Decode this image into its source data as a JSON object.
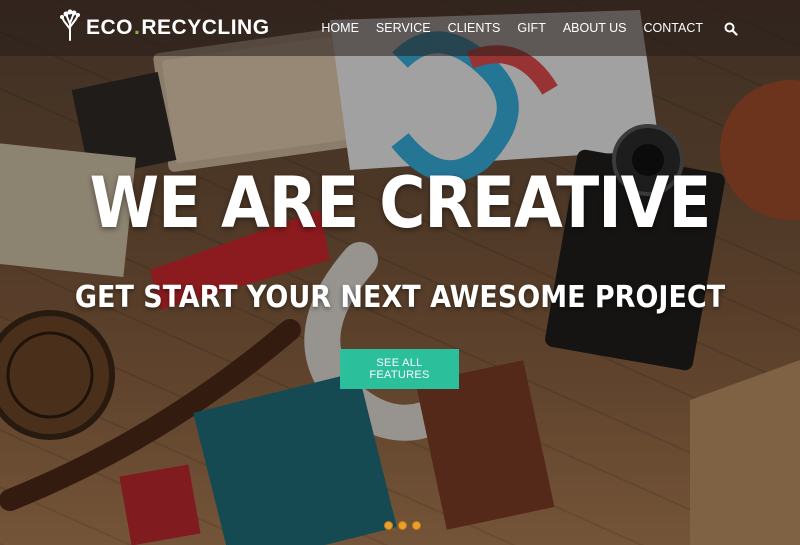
{
  "brand": {
    "name_part1": "ECO",
    "dot": ".",
    "name_part2": "RECYCLING"
  },
  "nav": {
    "items": [
      "HOME",
      "SERVICE",
      "CLIENTS",
      "GIFT",
      "ABOUT US",
      "CONTACT"
    ]
  },
  "hero": {
    "headline": "WE ARE CREATIVE",
    "subline": "GET START YOUR NEXT AWESOME PROJECT",
    "cta_label": "SEE ALL FEATURES"
  },
  "colors": {
    "accent": "#2bbf9c",
    "logo_dot": "#7dbb3a",
    "indicator": "#e8a12a"
  },
  "slider": {
    "indicators": 3
  }
}
